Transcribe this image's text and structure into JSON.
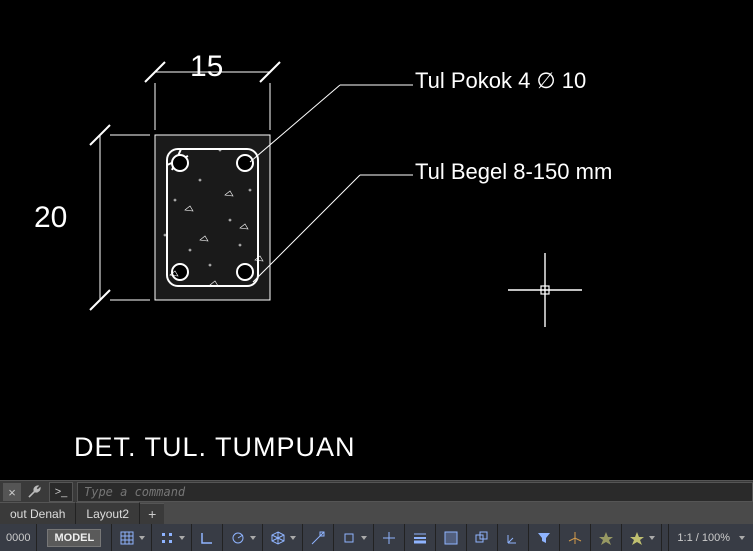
{
  "drawing": {
    "dim_width": "15",
    "dim_height": "20",
    "annotation1": "Tul Pokok 4 ∅ 10",
    "annotation2": "Tul Begel 8-150 mm",
    "title": "DET. TUL. TUMPUAN"
  },
  "command": {
    "placeholder": "Type a command",
    "prompt": ">_"
  },
  "tabs": {
    "tab1": "out Denah",
    "tab2": "Layout2"
  },
  "status": {
    "coords": "0000",
    "model": "MODEL",
    "zoom": "1:1 / 100%"
  }
}
